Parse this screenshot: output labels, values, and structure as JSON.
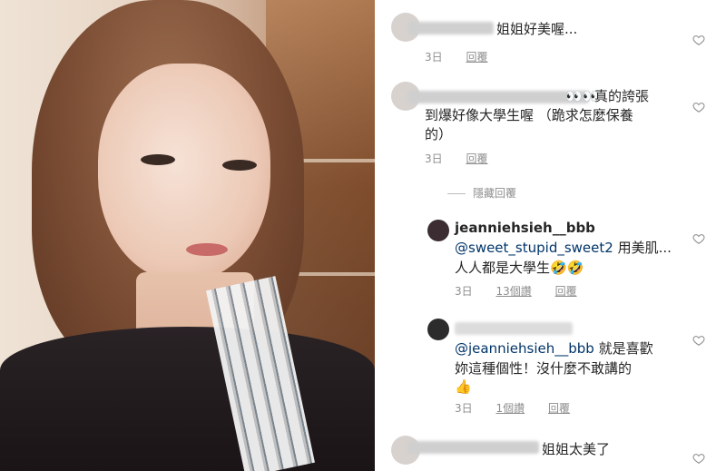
{
  "comments": [
    {
      "text": "姐姐好美喔...",
      "time": "3日",
      "reply": "回覆"
    },
    {
      "emoji": "👀👀",
      "line1": "真的誇張",
      "line2": "到爆好像大學生喔 （跪求怎麼保養",
      "line3": "的）",
      "time": "3日",
      "reply": "回覆"
    },
    {
      "text": "姐姐太美了"
    }
  ],
  "hide_replies": "隱藏回覆",
  "replies": [
    {
      "user": "jeanniehsieh__bbb",
      "mention": "@sweet_stupid_sweet2",
      "line1": "用美肌...",
      "line2": "人人都是大學生🤣🤣",
      "time": "3日",
      "likes": "13個讚",
      "reply": "回覆"
    },
    {
      "mention": "@jeanniehsieh__bbb",
      "line1": "就是喜歡",
      "line2": "妳這種個性！沒什麼不敢講的",
      "line3": "👍",
      "time": "3日",
      "likes": "1個讚",
      "reply": "回覆"
    }
  ],
  "colors": {
    "mention": "#003569",
    "meta": "#8e8e8e",
    "text": "#262626"
  }
}
